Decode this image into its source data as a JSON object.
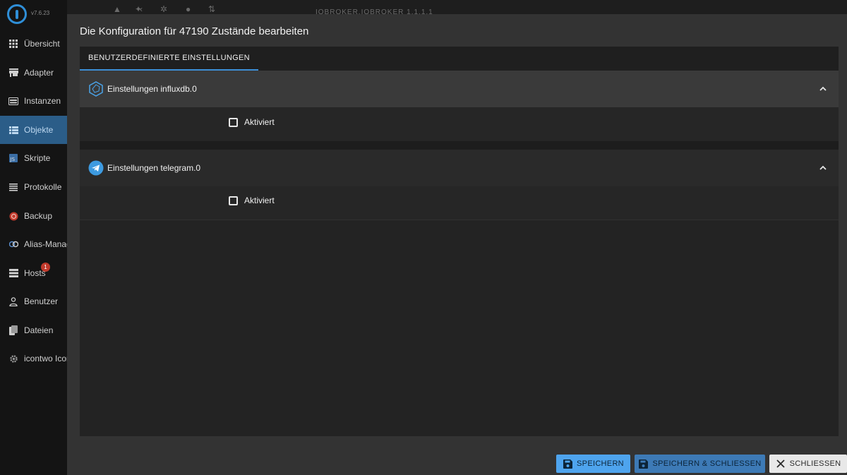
{
  "app": {
    "version": "v7.6.23"
  },
  "sidebar": {
    "items": [
      {
        "label": "Übersicht",
        "icon": "grid-icon"
      },
      {
        "label": "Adapter",
        "icon": "store-icon"
      },
      {
        "label": "Instanzen",
        "icon": "keyboard-icon"
      },
      {
        "label": "Objekte",
        "icon": "list-icon"
      },
      {
        "label": "Skripte",
        "icon": "js-icon"
      },
      {
        "label": "Protokolle",
        "icon": "lines-icon"
      },
      {
        "label": "Backup",
        "icon": "backup-icon"
      },
      {
        "label": "Alias-Manager",
        "icon": "alias-icon"
      },
      {
        "label": "Hosts",
        "icon": "hosts-icon",
        "badge": "1"
      },
      {
        "label": "Benutzer",
        "icon": "user-icon"
      },
      {
        "label": "Dateien",
        "icon": "files-icon"
      },
      {
        "label": "icontwo Icons",
        "icon": "gear-icon"
      }
    ]
  },
  "topbar": {
    "title": "IOBROKER.IOBROKER 1.1.1.1"
  },
  "dialog": {
    "title": "Die Konfiguration für 47190 Zustände bearbeiten",
    "tab": "BENUTZERDEFINIERTE EINSTELLUNGEN",
    "sections": [
      {
        "title": "Einstellungen influxdb.0",
        "checkbox_label": "Aktiviert",
        "checked": false
      },
      {
        "title": "Einstellungen telegram.0",
        "checkbox_label": "Aktiviert",
        "checked": false
      }
    ],
    "buttons": {
      "save": "SPEICHERN",
      "save_close": "SPEICHERN & SCHLIESSEN",
      "close": "SCHLIESSEN"
    }
  },
  "colors": {
    "accent": "#3d8fd6",
    "active_nav": "#2b5d88",
    "save": "#4ea4ee"
  }
}
